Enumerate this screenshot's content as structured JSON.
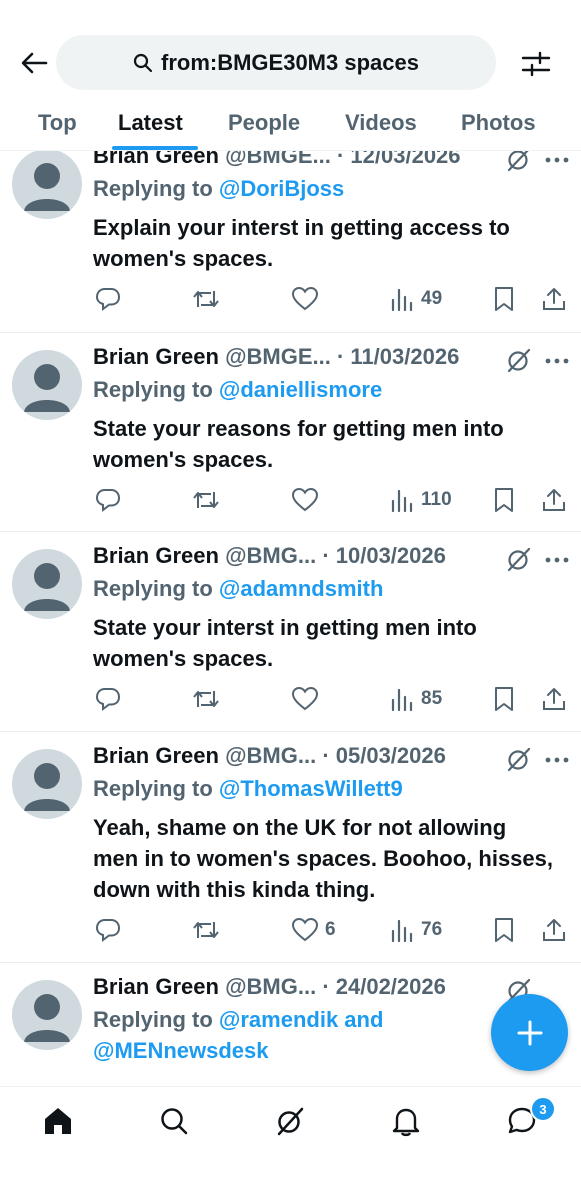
{
  "search": {
    "query": "from:BMGE30M3 spaces"
  },
  "tabs": [
    {
      "label": "Top"
    },
    {
      "label": "Latest",
      "active": true
    },
    {
      "label": "People"
    },
    {
      "label": "Videos"
    },
    {
      "label": "Photos"
    }
  ],
  "tweets": [
    {
      "name": "Brian Green",
      "handle": "@BMGE...",
      "date": "· 12/03/2026",
      "reply_prefix": "Replying to",
      "reply_to": "@DoriBjoss",
      "text": "Explain your interst in getting access to women's spaces.",
      "likes": "",
      "views": "49"
    },
    {
      "name": "Brian Green",
      "handle": "@BMGE...",
      "date": "· 11/03/2026",
      "reply_prefix": "Replying to",
      "reply_to": "@daniellismore",
      "text": "State your reasons for getting men into women's spaces.",
      "likes": "",
      "views": "110"
    },
    {
      "name": "Brian Green",
      "handle": "@BMG...",
      "date": "· 10/03/2026",
      "reply_prefix": "Replying to",
      "reply_to": "@adamndsmith",
      "text": "State your interst in getting men into women's spaces.",
      "likes": "",
      "views": "85"
    },
    {
      "name": "Brian Green",
      "handle": "@BMG...",
      "date": "· 05/03/2026",
      "reply_prefix": "Replying to",
      "reply_to": "@ThomasWillett9",
      "text": "Yeah, shame on the UK for not allowing men in to women's  spaces. Boohoo, hisses,  down with this kinda thing.",
      "likes": "6",
      "views": "76"
    },
    {
      "name": "Brian Green",
      "handle": "@BMG...",
      "date": "· 24/02/2026",
      "reply_prefix": "Replying to",
      "reply_to": "@ramendik and",
      "reply_to_2": "@MENnewsdesk"
    }
  ],
  "nav": {
    "messages_badge": "3"
  },
  "icons": {
    "back": "back-arrow-icon",
    "search": "search-icon",
    "filter": "filter-sliders-icon",
    "reply": "reply-icon",
    "repost": "repost-icon",
    "like": "heart-icon",
    "views": "views-icon",
    "bookmark": "bookmark-icon",
    "share": "share-icon",
    "grok": "grok-icon",
    "more": "more-icon",
    "compose": "plus-icon",
    "home": "home-icon",
    "explore": "search-icon",
    "notifications": "bell-icon",
    "messages": "chat-bubble-icon"
  },
  "colors": {
    "accent": "#1d9bf0",
    "secondary_text": "#536471",
    "primary_text": "#0f1419",
    "avatar_bg": "#cfd9de"
  }
}
